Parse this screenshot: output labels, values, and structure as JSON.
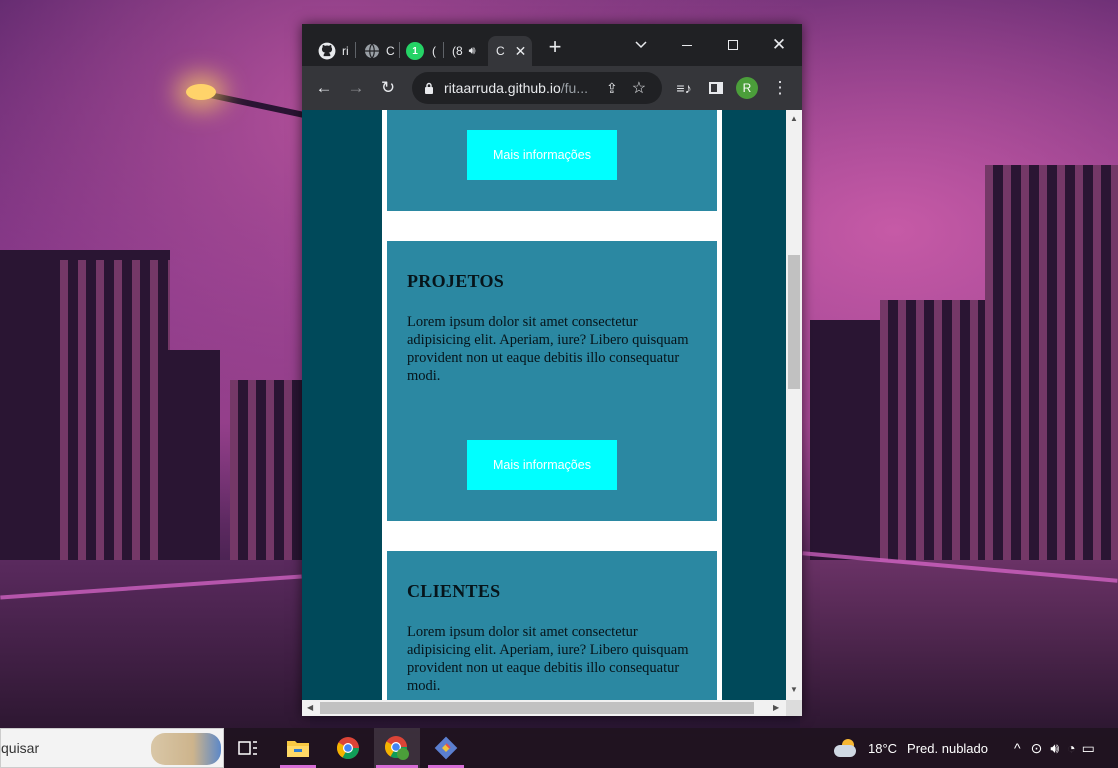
{
  "browser": {
    "tabs": [
      {
        "title": "ri",
        "icon": "github-icon"
      },
      {
        "title": "C",
        "icon": "globe-icon"
      },
      {
        "title": "(",
        "icon": "whatsapp-icon",
        "badge": "1"
      },
      {
        "title": "(8",
        "icon": "speaker-icon"
      },
      {
        "title": "C",
        "icon": "loading-icon",
        "active": true
      }
    ],
    "url_host": "ritaarruda.github.io",
    "url_path": "/fu...",
    "profile_initial": "R"
  },
  "page": {
    "top_card": {
      "button_label": "Mais informações"
    },
    "cards": [
      {
        "heading": "PROJETOS",
        "text": "Lorem ipsum dolor sit amet consectetur adipisicing elit. Aperiam, iure? Libero quisquam provident non ut eaque debitis illo consequatur modi.",
        "button_label": "Mais informações"
      },
      {
        "heading": "CLIENTES",
        "text": "Lorem ipsum dolor sit amet consectetur adipisicing elit. Aperiam, iure? Libero quisquam provident non ut eaque debitis illo consequatur modi."
      }
    ]
  },
  "taskbar": {
    "search_text": "quisar",
    "weather_temp": "18°C",
    "weather_desc": "Pred. nublado",
    "apps": [
      "task-view-icon",
      "file-explorer-icon",
      "chrome-icon",
      "chrome-profile-icon",
      "git-icon"
    ]
  },
  "colors": {
    "sidebar": "#00495a",
    "card": "#2b88a2",
    "button": "#00ffff",
    "browser_frame": "#202124",
    "toolbar": "#35363a"
  }
}
